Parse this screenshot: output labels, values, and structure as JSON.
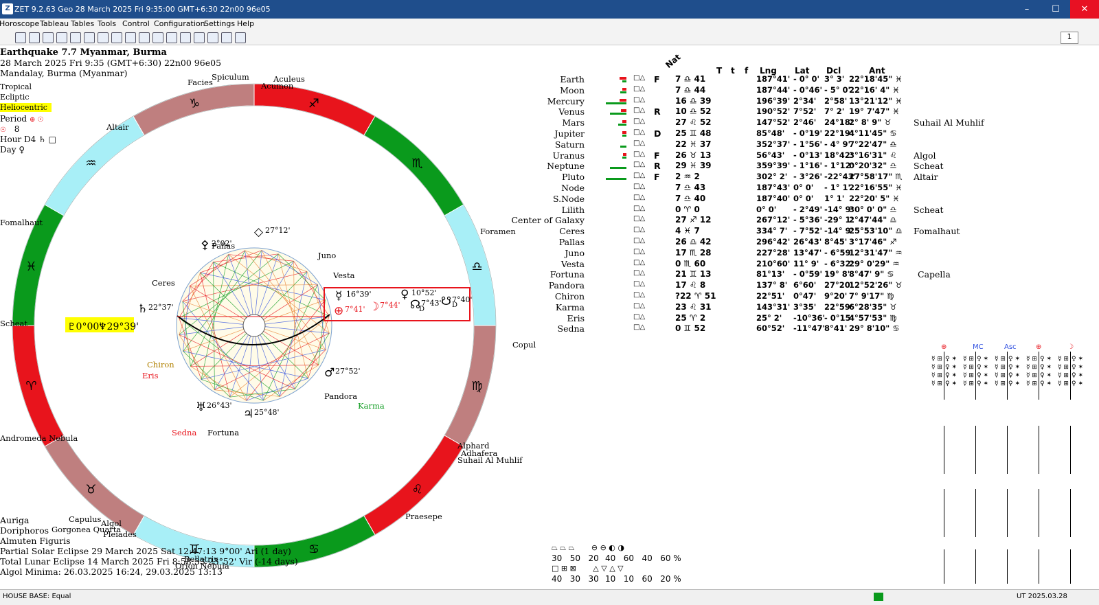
{
  "window": {
    "title": "ZET 9.2.63 Geo    28 March 2025  Fri    9:35:00 GMT+6:30 22n00  96e05",
    "app_icon": "Z",
    "buttons": [
      "–",
      "☐",
      "✕"
    ]
  },
  "menu": [
    "Horoscope",
    "Tableau",
    "Tables",
    "Tools",
    "Control",
    "Configuration",
    "Settings",
    "Help"
  ],
  "toolbar": {
    "icons": [
      "bar-icon",
      "grid-icon",
      "globe-icon",
      "wheel-icon",
      "earth-icon",
      "moon-icon",
      "chart-icon",
      "pointer-icon",
      "table-icon",
      "sheet-icon",
      "calendar-icon",
      "map-icon",
      "world-icon",
      "target-icon",
      "tools-icon",
      "scales-icon",
      "plant-icon"
    ],
    "page_value": "1"
  },
  "header": {
    "title": "Earthquake 7.7 Myanmar, Burma",
    "datetime": "28 March 2025  Fri   9:35 (GMT+6:30) 22n00  96e05",
    "place": "Mandalay, Burma (Myanmar)"
  },
  "options": {
    "zodiac": "Tropical",
    "coords": "Ecliptic",
    "centric": "Heliocentric",
    "period_label": "Period",
    "period_sym": "⊕ ☉",
    "line5_sym": "☉",
    "line5_val": "8",
    "hour_label": "Hour D4",
    "hour_sym": "♄ □",
    "day_label": "Day",
    "day_sym": "♀"
  },
  "wheel": {
    "signs": [
      "♐",
      "♏",
      "♎",
      "♍",
      "♌",
      "♋",
      "♊",
      "♉",
      "♈",
      "♓",
      "♒",
      "♑"
    ],
    "stars": [
      "Spiculum",
      "Aculeus",
      "Acumen",
      "Facies",
      "Altair",
      "Fomalhaut",
      "Foramen",
      "Copula",
      "Alphard",
      "Adhafera",
      "Suhail Al Muhlif",
      "Praesepe",
      "Algol",
      "Capulus",
      "Gorgonea Quarta",
      "Pleiades",
      "Orion Nebula",
      "Bellatrix",
      "Scheat",
      "Andromeda Nebula"
    ],
    "planets": [
      {
        "sym": "⚴",
        "label": "Pallas",
        "deg": "2°02'"
      },
      {
        "sym": "◇",
        "label": "",
        "deg": "27°12'"
      },
      {
        "sym": "",
        "label": "Juno",
        "deg": ""
      },
      {
        "sym": "",
        "label": "Vesta",
        "deg": ""
      },
      {
        "sym": "",
        "label": "Ceres",
        "deg": ""
      },
      {
        "sym": "♄",
        "label": "",
        "deg": "22°37'"
      },
      {
        "sym": "☿",
        "label": "",
        "deg": "16°39'"
      },
      {
        "sym": "♀",
        "label": "",
        "deg": "10°52'"
      },
      {
        "sym": "☊",
        "label": "",
        "deg": "7°43'"
      },
      {
        "sym": "☋",
        "label": "",
        "deg": "7°40'"
      },
      {
        "sym": "⊕",
        "label": "",
        "deg": "7°41'"
      },
      {
        "sym": "☽",
        "label": "",
        "deg": "7°44'"
      },
      {
        "sym": "♂",
        "label": "",
        "deg": "27°52'"
      },
      {
        "sym": "♅",
        "label": "",
        "deg": "26°43'"
      },
      {
        "sym": "♃",
        "label": "",
        "deg": "25°48'"
      },
      {
        "sym": "",
        "label": "Chiron",
        "deg": ""
      },
      {
        "sym": "",
        "label": "Eris",
        "deg": ""
      },
      {
        "sym": "",
        "label": "Sedna",
        "deg": ""
      },
      {
        "sym": "",
        "label": "Fortuna",
        "deg": ""
      },
      {
        "sym": "",
        "label": "Pandora",
        "deg": ""
      },
      {
        "sym": "",
        "label": "Karma",
        "deg": ""
      }
    ],
    "highlight": {
      "pluto": "♇0°00'",
      "neptune": "♆29°39'"
    },
    "node_marks": [
      "D",
      "D"
    ]
  },
  "table": {
    "title": "Nat",
    "headers": [
      "T",
      "t",
      "f",
      "Lng",
      "Lat",
      "Dcl",
      "Ant"
    ],
    "rows": [
      {
        "name": "Earth",
        "flag": "F",
        "lng": "187°41'",
        "lat": "- 0° 0'",
        "dcl": "3° 3'",
        "ant": "22°18'45\" ♓",
        "pos": "7 ♎ 41",
        "star": ""
      },
      {
        "name": "Moon",
        "flag": "",
        "lng": "187°44'",
        "lat": "- 0°46'",
        "dcl": "- 5° 0'",
        "ant": "22°16' 4\" ♓",
        "pos": "7 ♎ 44",
        "star": ""
      },
      {
        "name": "Mercury",
        "flag": "",
        "lng": "196°39'",
        "lat": "2°34'",
        "dcl": "2°58'",
        "ant": "13°21'12\" ♓",
        "pos": "16 ♎ 39",
        "star": ""
      },
      {
        "name": "Venus",
        "flag": "R",
        "lng": "190°52'",
        "lat": "7°52'",
        "dcl": "7° 2'",
        "ant": "19° 7'47\" ♓",
        "pos": "10 ♎ 52",
        "star": ""
      },
      {
        "name": "Mars",
        "flag": "",
        "lng": "147°52'",
        "lat": "2°46'",
        "dcl": "24°18'",
        "ant": "2° 8' 9\" ♉",
        "pos": "27 ♌ 52",
        "star": "Suhail Al Muhlif"
      },
      {
        "name": "Jupiter",
        "flag": "D",
        "lng": "85°48'",
        "lat": "- 0°19'",
        "dcl": "22°19'",
        "ant": "4°11'45\" ♋",
        "pos": "25 ♊ 48",
        "star": ""
      },
      {
        "name": "Saturn",
        "flag": "",
        "lng": "352°37'",
        "lat": "- 1°56'",
        "dcl": "- 4° 9'",
        "ant": "7°22'47\" ♎",
        "pos": "22 ♓ 37",
        "star": ""
      },
      {
        "name": "Uranus",
        "flag": "F",
        "lng": "56°43'",
        "lat": "- 0°13'",
        "dcl": "18°42'",
        "ant": "3°16'31\" ♌",
        "pos": "26 ♉ 13",
        "star": "Algol"
      },
      {
        "name": "Neptune",
        "flag": "R",
        "lng": "359°39'",
        "lat": "- 1°16'",
        "dcl": "- 1°12'",
        "ant": "0°20'32\" ♎",
        "pos": "29 ♓ 39",
        "star": "Scheat"
      },
      {
        "name": "Pluto",
        "flag": "F",
        "lng": "302° 2'",
        "lat": "- 3°26'",
        "dcl": "-22°43'",
        "ant": "27°58'17\" ♏",
        "pos": "2 ♒ 2",
        "star": "Altair"
      },
      {
        "name": "Node",
        "flag": "",
        "lng": "187°43'",
        "lat": "0° 0'",
        "dcl": "- 1° 1'",
        "ant": "22°16'55\" ♓",
        "pos": "7 ♎ 43",
        "star": ""
      },
      {
        "name": "S.Node",
        "flag": "",
        "lng": "187°40'",
        "lat": "0° 0'",
        "dcl": "1° 1'",
        "ant": "22°20' 5\" ♓",
        "pos": "7 ♎ 40",
        "star": ""
      },
      {
        "name": "Lilith",
        "flag": "",
        "lng": "0° 0'",
        "lat": "- 2°49'",
        "dcl": "-14° 9'",
        "ant": "30° 0' 0\" ♎",
        "pos": "0 ♈ 0",
        "star": "Scheat"
      },
      {
        "name": "Center of Galaxy",
        "flag": "",
        "lng": "267°12'",
        "lat": "- 5°36'",
        "dcl": "-29° 1'",
        "ant": "2°47'44\" ♎",
        "pos": "27 ♐ 12",
        "star": ""
      },
      {
        "name": "Ceres",
        "flag": "",
        "lng": "334° 7'",
        "lat": "- 7°52'",
        "dcl": "-14° 9'",
        "ant": "25°53'10\" ♎",
        "pos": "4 ♓ 7",
        "star": "Fomalhaut"
      },
      {
        "name": "Pallas",
        "flag": "",
        "lng": "296°42'",
        "lat": "26°43'",
        "dcl": "8°45'",
        "ant": "3°17'46\" ♐",
        "pos": "26 ♎ 42",
        "star": ""
      },
      {
        "name": "Juno",
        "flag": "",
        "lng": "227°28'",
        "lat": "13°47'",
        "dcl": "- 6°59'",
        "ant": "12°31'47\" ♒",
        "pos": "17 ♏ 28",
        "star": ""
      },
      {
        "name": "Vesta",
        "flag": "",
        "lng": "210°60'",
        "lat": "11° 9'",
        "dcl": "- 6°32'",
        "ant": "29° 0'29\" ♒",
        "pos": "0 ♏ 60",
        "star": ""
      },
      {
        "name": "Fortuna",
        "flag": "",
        "lng": "81°13'",
        "lat": "- 0°59'",
        "dcl": "19° 8'",
        "ant": "8°47' 9\" ♋",
        "pos": "21 ♊ 13",
        "star": "Capella"
      },
      {
        "name": "Pandora",
        "flag": "",
        "lng": "137° 8'",
        "lat": "6°60'",
        "dcl": "27°20'",
        "ant": "12°52'26\" ♉",
        "pos": "17 ♌ 8",
        "star": ""
      },
      {
        "name": "Chiron",
        "flag": "",
        "lng": "22°51'",
        "lat": "0°47'",
        "dcl": "9°20'",
        "ant": "7° 9'17\" ♍",
        "pos": "?22 ♈ 51",
        "star": ""
      },
      {
        "name": "Karma",
        "flag": "",
        "lng": "143°31'",
        "lat": "3°35'",
        "dcl": "22°59'",
        "ant": "6°28'35\" ♉",
        "pos": "23 ♌ 31",
        "star": ""
      },
      {
        "name": "Eris",
        "flag": "",
        "lng": "25° 2'",
        "lat": "-10°36'",
        "dcl": "- 0°15'",
        "ant": "4°57'53\" ♍",
        "pos": "25 ♈ 2",
        "star": ""
      },
      {
        "name": "Sedna",
        "flag": "",
        "lng": "60°52'",
        "lat": "-11°47'",
        "dcl": "8°41'",
        "ant": "29° 8'10\" ♋",
        "pos": "0 ♊ 52",
        "star": ""
      }
    ]
  },
  "lower_left": {
    "auriga": "Auriga",
    "doriphoros": "Doriphoros",
    "almuten": "Almuten Figuris",
    "eclipse1": "Partial Solar Eclipse 29 March 2025 Sat 12:47:13  9°00' Ari (1 day)",
    "eclipse2": "Total Lunar Eclipse 14 March 2025 Fri  8:58:33  23°52' Vir (-14 days)",
    "algol": "Algol Minima: 26.03.2025 16:24,  29.03.2025 13:13"
  },
  "stats": {
    "row1_vals": [
      "30",
      "50",
      "20"
    ],
    "row1_vals2": [
      "40",
      "60",
      "40",
      "60 %"
    ],
    "row2_vals": [
      "40",
      "30",
      "30"
    ],
    "row2_vals2": [
      "10",
      "10",
      "60",
      "20 %"
    ]
  },
  "grids": [
    "⊕",
    "MC",
    "Asc",
    "⊕",
    "☽"
  ],
  "status": {
    "left": "HOUSE BASE: Equal",
    "right": "UT  2025.03.28"
  },
  "colors": {
    "red": "#e8141c",
    "green": "#0a9a1c",
    "cyan": "#a8eff7",
    "rose": "#bf7f7f",
    "titlebar": "#1f4e8c"
  }
}
